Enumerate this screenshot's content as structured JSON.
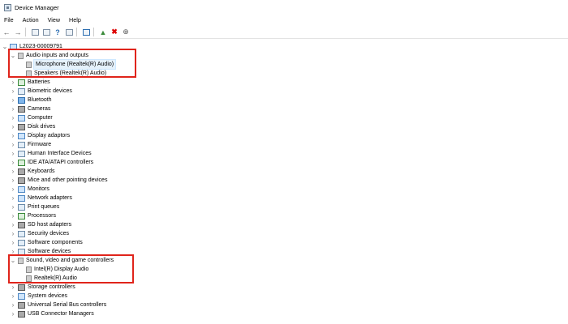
{
  "window": {
    "title": "Device Manager"
  },
  "menu": [
    "File",
    "Action",
    "View",
    "Help"
  ],
  "toolbar": {
    "buttons": [
      "back-arrow-icon",
      "forward-arrow-icon",
      "properties-icon",
      "show-hidden-icon",
      "help-icon",
      "view-icon",
      "monitor-icon",
      "update-driver-icon",
      "uninstall-icon",
      "scan-hardware-icon"
    ]
  },
  "tree": {
    "root": "L2023-00009791",
    "audio": {
      "label": "Audio inputs and outputs",
      "children": [
        "Microphone (Realtek(R) Audio)",
        "Speakers (Realtek(R) Audio)"
      ]
    },
    "middle": [
      "Batteries",
      "Biometric devices",
      "Bluetooth",
      "Cameras",
      "Computer",
      "Disk drives",
      "Display adaptors",
      "Firmware",
      "Human Interface Devices",
      "IDE ATA/ATAPI controllers",
      "Keyboards",
      "Mice and other pointing devices",
      "Monitors",
      "Network adapters",
      "Print queues",
      "Processors",
      "SD host adapters",
      "Security devices",
      "Software components",
      "Software devices"
    ],
    "sound": {
      "label": "Sound, video and game controllers",
      "children": [
        "Intel(R) Display Audio",
        "Realtek(R) Audio"
      ]
    },
    "bottom": [
      "Storage controllers",
      "System devices",
      "Universal Serial Bus controllers",
      "USB Connector Managers"
    ]
  },
  "colors": {
    "highlight": "#e0241b",
    "selection": "#e5f1fb"
  }
}
